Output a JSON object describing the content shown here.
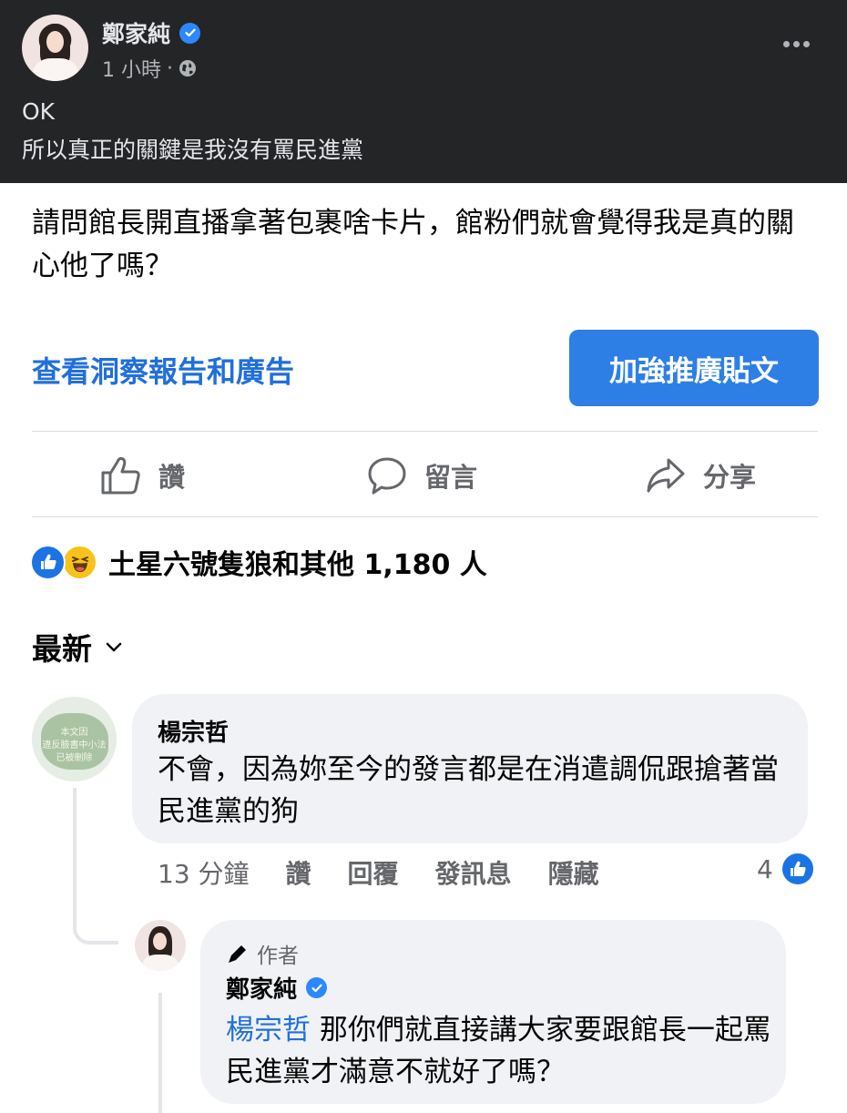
{
  "post_header": {
    "author_name": "鄭家純",
    "time": "1 小時",
    "meta_sep": "·",
    "text_line1": "OK",
    "text_line2": "所以真正的關鍵是我沒有罵民進黨"
  },
  "post": {
    "text": "請問館長開直播拿著包裹啥卡片，館粉們就會覺得我是真的關心他了嗎？",
    "insights_link": "查看洞察報告和廣告",
    "boost_button": "加強推廣貼文"
  },
  "actions": {
    "like": "讚",
    "comment": "留言",
    "share": "分享"
  },
  "reactions": {
    "summary": "土星六號隻狼和其他 1,180 人"
  },
  "comments_sort": {
    "label": "最新"
  },
  "comment1": {
    "avatar_text1": "本文因",
    "avatar_text2": "違反臉書中小法",
    "avatar_text3": "已被刪除",
    "author": "楊宗哲",
    "text": "不會，因為妳至今的發言都是在消遣調侃跟搶著當民進黨的狗",
    "time": "13 分鐘",
    "like": "讚",
    "reply": "回覆",
    "message": "發訊息",
    "hide": "隱藏",
    "like_count": "4"
  },
  "reply": {
    "author_badge": "作者",
    "author": "鄭家純",
    "mention": "楊宗哲",
    "text": " 那你們就直接講大家要跟館長一起罵民進黨才滿意不就好了嗎？"
  },
  "colors": {
    "dark_bg": "#242526",
    "link_blue": "#216fdb",
    "button_blue": "#2d7fe6",
    "bubble_bg": "#f0f2f5",
    "secondary_text": "#65676b"
  }
}
